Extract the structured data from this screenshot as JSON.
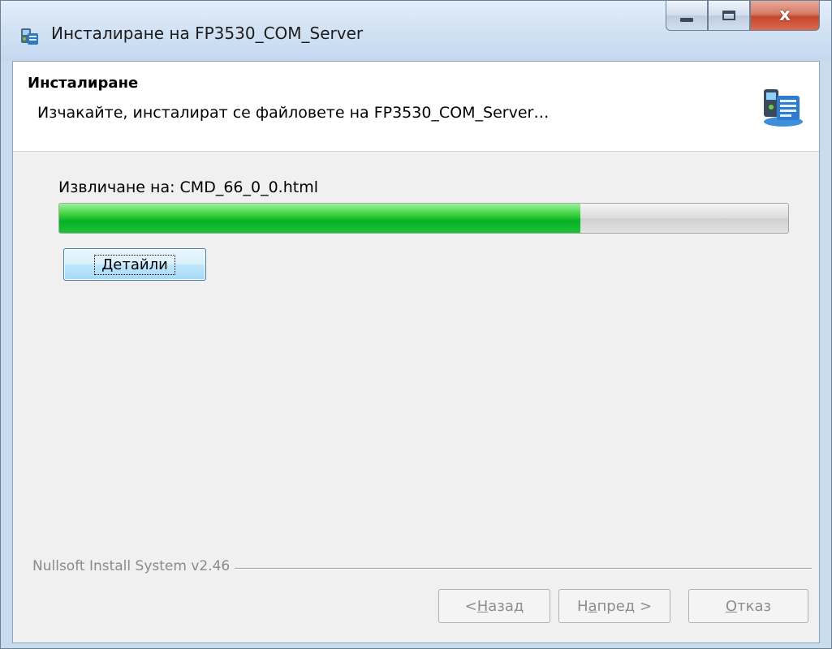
{
  "window": {
    "title": "Инсталиране на FP3530_COM_Server",
    "icon": "installer-icon",
    "caption_buttons": [
      "minimize-icon",
      "maximize-icon",
      "close-icon"
    ],
    "close_glyph": "x"
  },
  "header": {
    "title": "Инсталиране",
    "subtitle": "Изчакайте, инсталират се файловете на FP3530_COM_Server…",
    "icon": "install-package-icon"
  },
  "progress": {
    "status_text": "Извличане на: CMD_66_0_0.html",
    "percent": 71.5,
    "color": "#06b025"
  },
  "details_button": {
    "label_underlined": "Д",
    "label_rest": "етайли"
  },
  "branding": "Nullsoft Install System v2.46",
  "footer": {
    "back": {
      "prefix": "< ",
      "underlined": "Н",
      "rest": "азад",
      "enabled": false
    },
    "next": {
      "prefix": "Н",
      "underlined": "а",
      "rest": "пред >",
      "enabled": false
    },
    "cancel": {
      "prefix": "",
      "underlined": "О",
      "rest": "тказ",
      "enabled": false
    }
  }
}
